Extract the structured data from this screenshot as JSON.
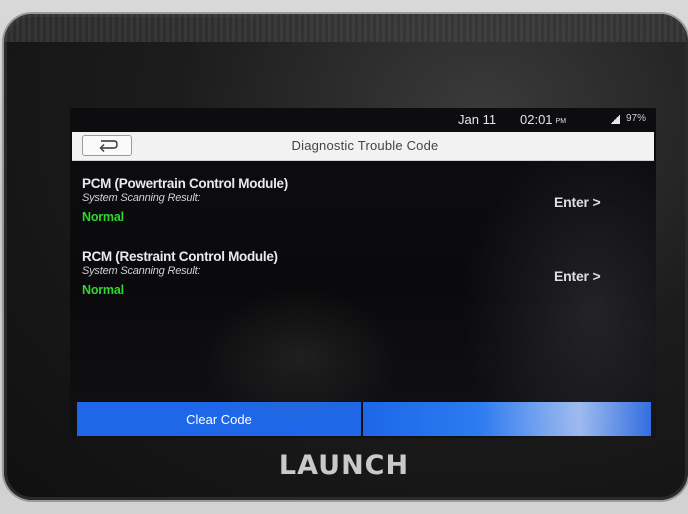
{
  "status_bar": {
    "date": "Jan 11",
    "time": "02:01",
    "ampm": "PM",
    "battery": "97%"
  },
  "header": {
    "title": "Diagnostic Trouble Code",
    "back_icon": "back-arrow-icon"
  },
  "modules": [
    {
      "name": "PCM (Powertrain Control Module)",
      "result_label": "System Scanning Result:",
      "status": "Normal",
      "enter_label": "Enter >"
    },
    {
      "name": "RCM (Restraint Control Module)",
      "result_label": "System Scanning Result:",
      "status": "Normal",
      "enter_label": "Enter >"
    }
  ],
  "footer": {
    "clear_label": "Clear Code"
  },
  "device": {
    "brand": "LAUNCH"
  },
  "colors": {
    "accent": "#1d67e8",
    "status_normal": "#2fd62f",
    "title_bar": "#f2f2f2"
  }
}
